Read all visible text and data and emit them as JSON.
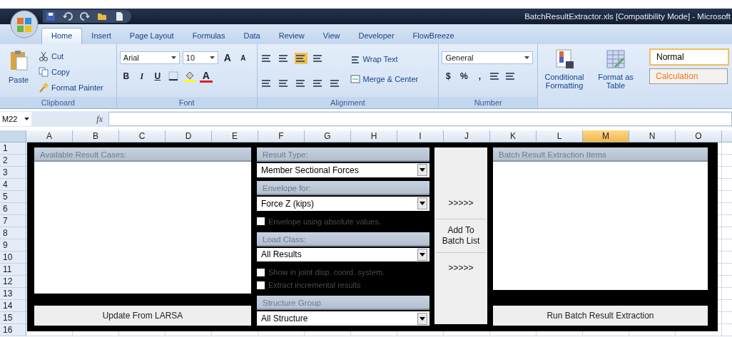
{
  "title_bar": {
    "title": "BatchResultExtractor.xls  [Compatibility Mode] - Microsoft"
  },
  "ribbon_tabs": [
    {
      "label": "Home",
      "selected": true
    },
    {
      "label": "Insert",
      "selected": false
    },
    {
      "label": "Page Layout",
      "selected": false
    },
    {
      "label": "Formulas",
      "selected": false
    },
    {
      "label": "Data",
      "selected": false
    },
    {
      "label": "Review",
      "selected": false
    },
    {
      "label": "View",
      "selected": false
    },
    {
      "label": "Developer",
      "selected": false
    },
    {
      "label": "FlowBreeze",
      "selected": false
    }
  ],
  "clipboard": {
    "label": "Clipboard",
    "paste": "Paste",
    "cut": "Cut",
    "copy": "Copy",
    "format_painter": "Format Painter"
  },
  "font": {
    "label": "Font",
    "name": "Arial",
    "size": "10",
    "grow": "A",
    "shrink": "A",
    "bold": "B",
    "italic": "I",
    "underline": "U",
    "font_color": "A"
  },
  "alignment": {
    "label": "Alignment",
    "wrap_text": "Wrap Text",
    "merge_center": "Merge & Center"
  },
  "number": {
    "label": "Number",
    "format": "General",
    "currency": "$",
    "percent": "%",
    "comma": ","
  },
  "styles": {
    "conditional_formatting": "Conditional Formatting",
    "format_as_table": "Format as Table",
    "cell_styles": [
      {
        "label": "Normal",
        "kind": "normal"
      },
      {
        "label": "Calculation",
        "kind": "calculation"
      }
    ]
  },
  "formula_bar": {
    "name_box": "M22",
    "function_label": "fx"
  },
  "sheet": {
    "columns": [
      {
        "label": "A",
        "selected": false
      },
      {
        "label": "B",
        "selected": false
      },
      {
        "label": "C",
        "selected": false
      },
      {
        "label": "D",
        "selected": false
      },
      {
        "label": "E",
        "selected": false
      },
      {
        "label": "F",
        "selected": false
      },
      {
        "label": "G",
        "selected": false
      },
      {
        "label": "H",
        "selected": false
      },
      {
        "label": "I",
        "selected": false
      },
      {
        "label": "J",
        "selected": false
      },
      {
        "label": "K",
        "selected": false
      },
      {
        "label": "L",
        "selected": false
      },
      {
        "label": "M",
        "selected": true
      },
      {
        "label": "N",
        "selected": false
      },
      {
        "label": "O",
        "selected": false
      }
    ],
    "rows": [
      "1",
      "2",
      "3",
      "4",
      "5",
      "6",
      "7",
      "8",
      "9",
      "10",
      "11",
      "12",
      "13",
      "14",
      "15",
      "16"
    ]
  },
  "form": {
    "cases_panel": {
      "title": "Available Result Cases:",
      "button": "Update From LARSA"
    },
    "options": [
      {
        "kind": "header",
        "label": "Result Type:"
      },
      {
        "kind": "dropdown",
        "value": "Member Sectional Forces"
      },
      {
        "kind": "header",
        "label": "Envelope for:"
      },
      {
        "kind": "dropdown",
        "value": "Force Z (kips)"
      },
      {
        "kind": "checkbox",
        "label": "Envelope using absolute values.",
        "checked": false
      },
      {
        "kind": "header",
        "label": "Load Class:"
      },
      {
        "kind": "dropdown",
        "value": "All Results"
      },
      {
        "kind": "checkbox",
        "label": "Show in joint disp. coord. system.",
        "checked": false
      },
      {
        "kind": "checkbox",
        "label": "Extract incremental results",
        "checked": false
      },
      {
        "kind": "header",
        "label": "Structure Group"
      },
      {
        "kind": "dropdown",
        "value": "All Structure"
      }
    ],
    "add_button": {
      "top": ">>>>>",
      "label": "Add To Batch List",
      "bottom": ">>>>>"
    },
    "batch_panel": {
      "title": "Batch Result Extraction Items",
      "button": "Run Batch Result Extraction"
    }
  }
}
